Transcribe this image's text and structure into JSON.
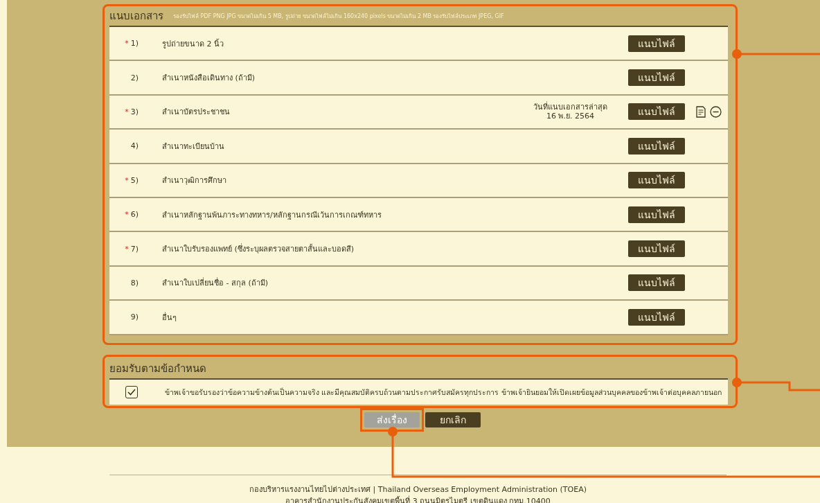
{
  "documents": {
    "title": "แนบเอกสาร",
    "hint": "รองรับไฟล์ PDF PNG JPG ขนาดไม่เกิน 5 MB, รูปถ่าย ขนาดไฟล์ไม่เกิน 160x240 pixels ขนาดไม่เกิน 2 MB รองรับไฟล์ประเภท JPEG, GIF",
    "rows": [
      {
        "required": "*",
        "number": "1)",
        "label": "รูปถ่ายขนาด 2 นิ้ว",
        "button": "แนบไฟล์",
        "attached": false
      },
      {
        "number": "2)",
        "label": "สำเนาหนังสือเดินทาง (ถ้ามี)",
        "button": "แนบไฟล์",
        "attached": false
      },
      {
        "required": "*",
        "number": "3)",
        "label": "สำเนาบัตรประชาชน",
        "date_label": "วันที่แนบเอกสารล่าสุด",
        "date": "16 พ.ย. 2564",
        "button": "แนบไฟล์",
        "attached": true
      },
      {
        "number": "4)",
        "label": "สำเนาทะเบียนบ้าน",
        "button": "แนบไฟล์",
        "attached": false
      },
      {
        "required": "*",
        "number": "5)",
        "label": "สำเนาวุฒิการศึกษา",
        "button": "แนบไฟล์",
        "attached": false
      },
      {
        "required": "*",
        "number": "6)",
        "label": "สำเนาหลักฐานพ้นภาระทางทหาร/หลักฐานกรณีเว้นการเกณฑ์ทหาร",
        "button": "แนบไฟล์",
        "attached": false
      },
      {
        "required": "*",
        "number": "7)",
        "label": "สำเนาใบรับรองแพทย์ (ซึ่งระบุผลตรวจสายตาสั้นและบอดสี)",
        "button": "แนบไฟล์",
        "attached": false
      },
      {
        "number": "8)",
        "label": "สำเนาใบเปลี่ยนชื่อ - สกุล (ถ้ามี)",
        "button": "แนบไฟล์",
        "attached": false
      },
      {
        "number": "9)",
        "label": "อื่นๆ",
        "button": "แนบไฟล์",
        "attached": false
      }
    ]
  },
  "terms": {
    "title": "ยอมรับตามข้อกำหนด",
    "checked": true,
    "text": "ข้าพเจ้าขอรับรองว่าข้อความข้างต้นเป็นความจริง และมีคุณสมบัติครบถ้วนตามประกาศรับสมัครทุกประการ ข้าพเจ้ายินยอมให้เปิดเผยข้อมูลส่วนบุคคลของข้าพเจ้าต่อบุคคลภายนอก"
  },
  "actions": [
    {
      "label": "ส่งเรื่อง",
      "kind": "submit",
      "disabled": true
    },
    {
      "label": "ยกเลิก",
      "kind": "cancel",
      "disabled": false
    }
  ],
  "footer": [
    "กองบริหารแรงงานไทยไปต่างประเทศ | Thailand Overseas Employment Administration (TOEA)",
    "อาคารสำนักงานประกันสังคมเขตพื้นที่ 3 ถนนมิตรไมตรี เขตดินแดง กทม.10400"
  ]
}
